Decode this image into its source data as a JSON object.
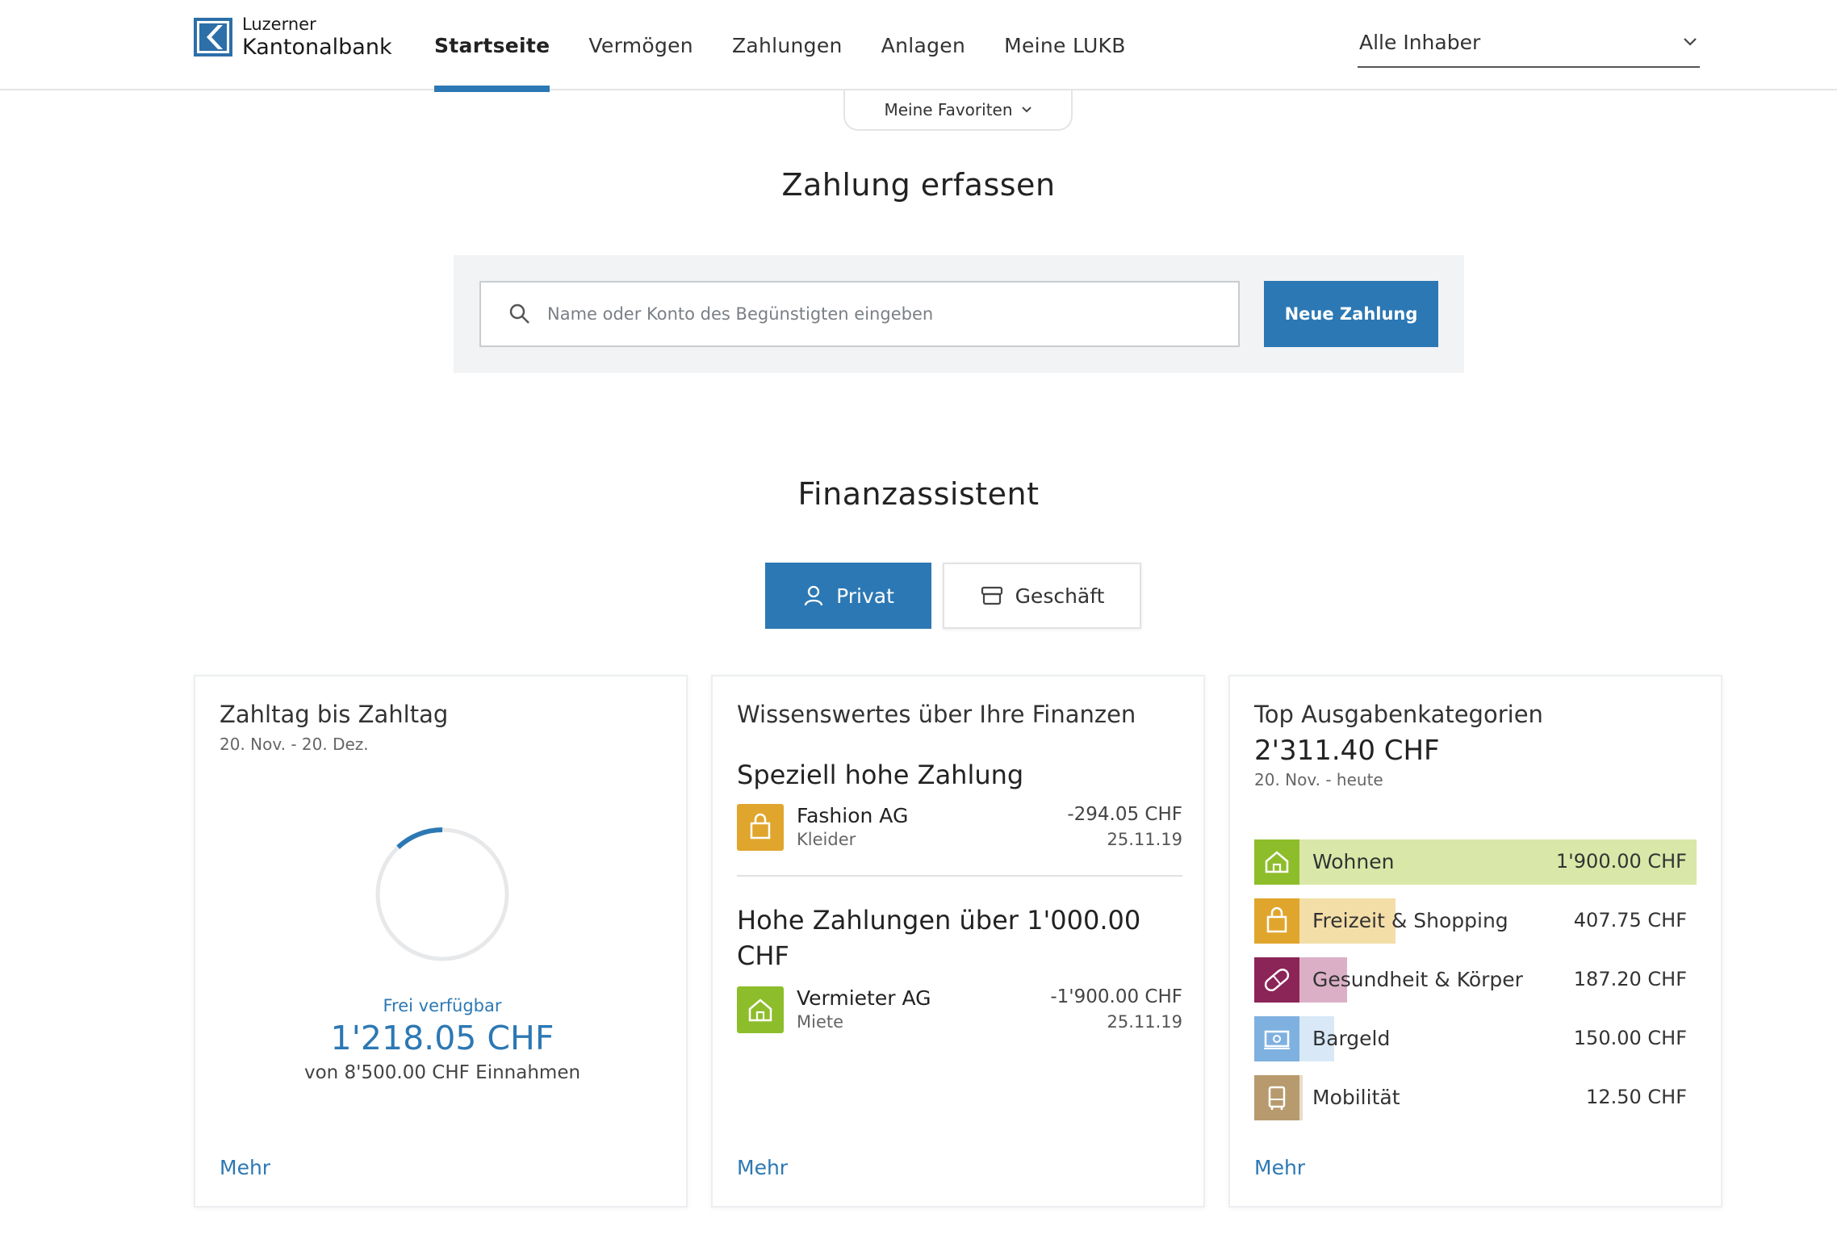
{
  "header": {
    "logo_line1": "Luzerner",
    "logo_line2": "Kantonalbank",
    "nav": [
      {
        "label": "Startseite",
        "active": true
      },
      {
        "label": "Vermögen"
      },
      {
        "label": "Zahlungen"
      },
      {
        "label": "Anlagen"
      },
      {
        "label": "Meine LUKB"
      }
    ],
    "owner_select": "Alle Inhaber"
  },
  "favorites_tab": "Meine Favoriten",
  "payment": {
    "title": "Zahlung erfassen",
    "search_placeholder": "Name oder Konto des Begünstigten eingeben",
    "new_button": "Neue Zahlung"
  },
  "assistant": {
    "title": "Finanzassistent",
    "toggle_privat": "Privat",
    "toggle_geschaeft": "Geschäft"
  },
  "card_zahltag": {
    "title": "Zahltag bis Zahltag",
    "period": "20. Nov. - 20. Dez.",
    "progress": 0.12,
    "free_label": "Frei verfügbar",
    "free_amount": "1'218.05 CHF",
    "from_income": "von 8'500.00 CHF Einnahmen",
    "more": "Mehr"
  },
  "card_wissen": {
    "title": "Wissenswertes über Ihre Finanzen",
    "section1_title": "Speziell hohe Zahlung",
    "tx1": {
      "name": "Fashion AG",
      "category": "Kleider",
      "amount": "-294.05 CHF",
      "date": "25.11.19",
      "icon": "shopping-bag-icon"
    },
    "section2_title": "Hohe Zahlungen über 1'000.00 CHF",
    "tx2": {
      "name": "Vermieter AG",
      "category": "Miete",
      "amount": "-1'900.00 CHF",
      "date": "25.11.19",
      "icon": "house-icon"
    },
    "more": "Mehr"
  },
  "card_top": {
    "title": "Top Ausgabenkategorien",
    "total": "2'311.40 CHF",
    "period": "20. Nov. - heute",
    "categories": [
      {
        "label": "Wohnen",
        "amount": "1'900.00 CHF",
        "share": 1.0,
        "color": "#8dbd2a",
        "bar": "#d9e8a8",
        "icon": "house-icon"
      },
      {
        "label": "Freizeit & Shopping",
        "amount": "407.75 CHF",
        "share": 0.32,
        "color": "#e0a52c",
        "bar": "#f4dea8",
        "icon": "shopping-bag-icon"
      },
      {
        "label": "Gesundheit & Körper",
        "amount": "187.20 CHF",
        "share": 0.21,
        "color": "#8b2457",
        "bar": "#dbb0c6",
        "icon": "bandage-icon"
      },
      {
        "label": "Bargeld",
        "amount": "150.00 CHF",
        "share": 0.18,
        "color": "#7fb1e0",
        "bar": "#d8e8f6",
        "icon": "banknote-icon"
      },
      {
        "label": "Mobilität",
        "amount": "12.50 CHF",
        "share": 0.11,
        "color": "#b79a6e",
        "bar": "#e8ddc9",
        "icon": "bus-icon"
      }
    ],
    "more": "Mehr"
  }
}
